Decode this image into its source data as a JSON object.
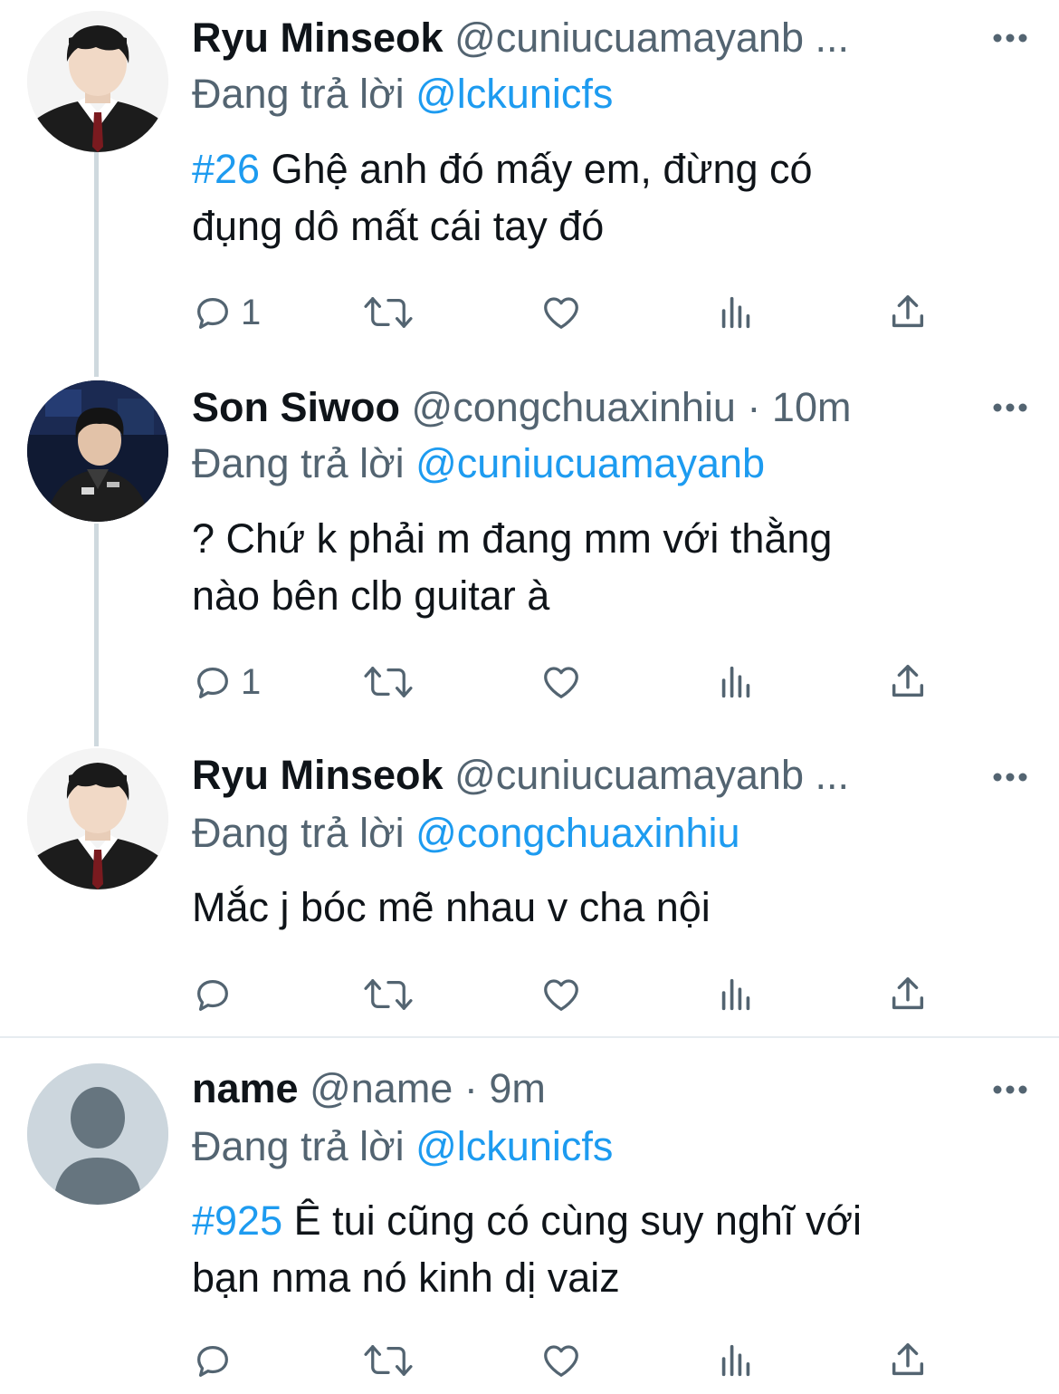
{
  "reply_label": "Đang trả lời",
  "tweets": [
    {
      "name": "Ryu Minseok",
      "handle_meta": "@cuniucuamayanb ...",
      "reply_to": "@lckunicfs",
      "hashtag": "#26",
      "line1": " Ghệ anh đó mấy em, đừng có",
      "line2": "đụng dô mất cái tay đó",
      "reply_count": "1"
    },
    {
      "name": "Son Siwoo",
      "handle_meta": "@congchuaxinhiu · 10m",
      "reply_to": "@cuniucuamayanb",
      "hashtag": "",
      "line1": "? Chứ k phải m đang mm với thằng",
      "line2": "nào bên clb guitar à",
      "reply_count": "1"
    },
    {
      "name": "Ryu Minseok",
      "handle_meta": "@cuniucuamayanb ...",
      "reply_to": "@congchuaxinhiu",
      "hashtag": "",
      "line1": "Mắc j bóc mẽ nhau v cha nội",
      "line2": "",
      "reply_count": ""
    },
    {
      "name": "name",
      "handle_meta": "@name · 9m",
      "reply_to": "@lckunicfs",
      "hashtag": "#925",
      "line1": " Ê tui cũng có cùng suy nghĩ với",
      "line2": "bạn nma nó kinh dị vaiz",
      "reply_count": ""
    }
  ],
  "colors": {
    "link": "#1d9bf0",
    "secondary": "#536471",
    "thread_line": "#cfd9de",
    "default_avatar_bg": "#ccd6dd"
  },
  "icons": [
    "reply-icon",
    "retweet-icon",
    "like-icon",
    "views-icon",
    "share-icon",
    "more-icon"
  ]
}
